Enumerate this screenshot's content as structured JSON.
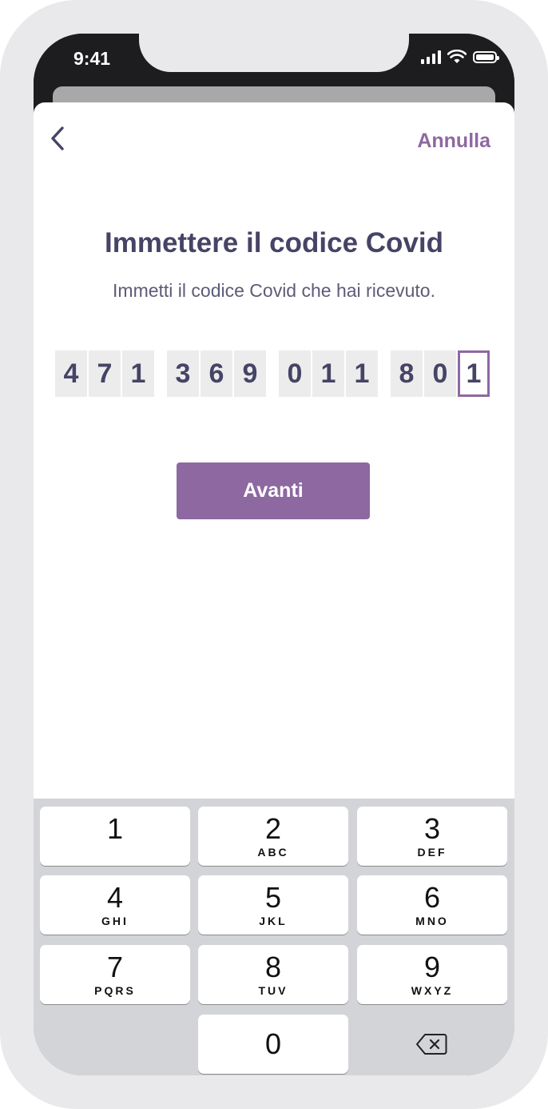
{
  "status_bar": {
    "time": "9:41"
  },
  "header": {
    "back_icon": "chevron-left-icon",
    "cancel_label": "Annulla"
  },
  "main": {
    "title": "Immettere il codice Covid",
    "subtitle": "Immetti il codice Covid che hai ricevuto.",
    "code_groups": [
      [
        "4",
        "7",
        "1"
      ],
      [
        "3",
        "6",
        "9"
      ],
      [
        "0",
        "1",
        "1"
      ],
      [
        "8",
        "0",
        "1"
      ]
    ],
    "next_label": "Avanti"
  },
  "keyboard": {
    "keys": [
      {
        "num": "1",
        "letters": ""
      },
      {
        "num": "2",
        "letters": "ABC"
      },
      {
        "num": "3",
        "letters": "DEF"
      },
      {
        "num": "4",
        "letters": "GHI"
      },
      {
        "num": "5",
        "letters": "JKL"
      },
      {
        "num": "6",
        "letters": "MNO"
      },
      {
        "num": "7",
        "letters": "PQRS"
      },
      {
        "num": "8",
        "letters": "TUV"
      },
      {
        "num": "9",
        "letters": "WXYZ"
      },
      {
        "num": "0",
        "letters": ""
      }
    ],
    "delete_icon": "backspace-icon"
  },
  "colors": {
    "accent": "#8e68a0",
    "title": "#454466"
  }
}
